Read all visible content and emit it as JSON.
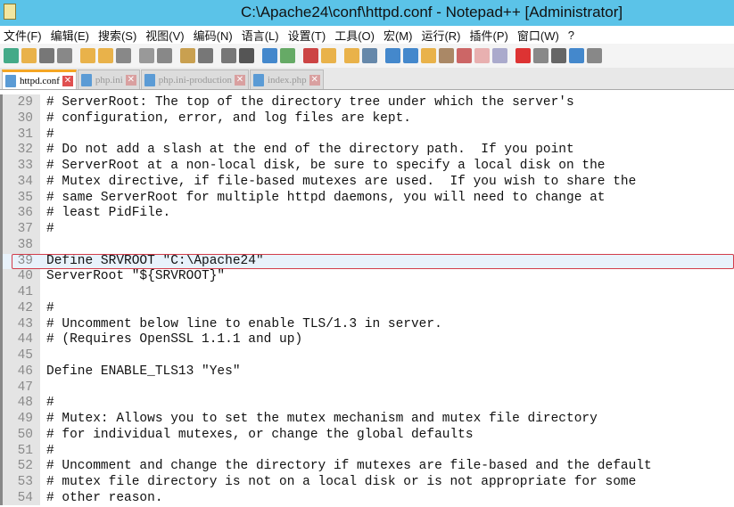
{
  "window": {
    "title": "C:\\Apache24\\conf\\httpd.conf - Notepad++ [Administrator]"
  },
  "menu": [
    "文件(F)",
    "编辑(E)",
    "搜索(S)",
    "视图(V)",
    "编码(N)",
    "语言(L)",
    "设置(T)",
    "工具(O)",
    "宏(M)",
    "运行(R)",
    "插件(P)",
    "窗口(W)",
    "?"
  ],
  "toolbar_colors": [
    "#4a8",
    "#e9b24a",
    "#777",
    "#888",
    "#e9b24a",
    "#e9b24a",
    "#888",
    "#999",
    "#888",
    "#c9a050",
    "#777",
    "#777",
    "#555",
    "#48c",
    "#6a6",
    "#c44",
    "#e9b24a",
    "#e9b24a",
    "#68a",
    "#48c",
    "#48c",
    "#e9b24a",
    "#a86",
    "#c66",
    "#e8b0b0",
    "#aac",
    "#d33",
    "#888",
    "#666",
    "#48c",
    "#888"
  ],
  "tabs": [
    {
      "label": "httpd.conf",
      "active": true
    },
    {
      "label": "php.ini"
    },
    {
      "label": "php.ini-production"
    },
    {
      "label": "index.php"
    }
  ],
  "editor": {
    "highlighted_line": "39",
    "lines": [
      [
        "29",
        "# ServerRoot: The top of the directory tree under which the server's"
      ],
      [
        "30",
        "# configuration, error, and log files are kept."
      ],
      [
        "31",
        "#"
      ],
      [
        "32",
        "# Do not add a slash at the end of the directory path.  If you point"
      ],
      [
        "33",
        "# ServerRoot at a non-local disk, be sure to specify a local disk on the"
      ],
      [
        "34",
        "# Mutex directive, if file-based mutexes are used.  If you wish to share the"
      ],
      [
        "35",
        "# same ServerRoot for multiple httpd daemons, you will need to change at"
      ],
      [
        "36",
        "# least PidFile."
      ],
      [
        "37",
        "#"
      ],
      [
        "38",
        ""
      ],
      [
        "39",
        "Define SRVROOT \"C:\\Apache24\""
      ],
      [
        "40",
        "ServerRoot \"${SRVROOT}\""
      ],
      [
        "41",
        ""
      ],
      [
        "42",
        "#"
      ],
      [
        "43",
        "# Uncomment below line to enable TLS/1.3 in server."
      ],
      [
        "44",
        "# (Requires OpenSSL 1.1.1 and up)"
      ],
      [
        "45",
        ""
      ],
      [
        "46",
        "Define ENABLE_TLS13 \"Yes\""
      ],
      [
        "47",
        ""
      ],
      [
        "48",
        "#"
      ],
      [
        "49",
        "# Mutex: Allows you to set the mutex mechanism and mutex file directory"
      ],
      [
        "50",
        "# for individual mutexes, or change the global defaults"
      ],
      [
        "51",
        "#"
      ],
      [
        "52",
        "# Uncomment and change the directory if mutexes are file-based and the default"
      ],
      [
        "53",
        "# mutex file directory is not on a local disk or is not appropriate for some"
      ],
      [
        "54",
        "# other reason."
      ]
    ]
  }
}
